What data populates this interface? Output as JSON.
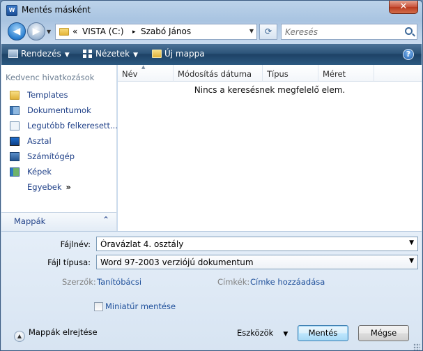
{
  "window": {
    "title": "Mentés másként",
    "app_icon_text": "W",
    "close_glyph": "✕"
  },
  "navigation": {
    "back_glyph": "◀",
    "forward_glyph": "▶",
    "breadcrumb_prefix": "«",
    "breadcrumb": [
      "VISTA (C:)",
      "Szabó János"
    ],
    "separator": "▸",
    "refresh_glyph": "⟳",
    "search_placeholder": "Keresés"
  },
  "toolbar": {
    "organize_label": "Rendezés",
    "views_label": "Nézetek",
    "new_folder_label": "Új mappa",
    "help_glyph": "?"
  },
  "favorites": {
    "heading": "Kedvenc hivatkozások",
    "items": [
      {
        "label": "Templates",
        "icon": "folder-icon"
      },
      {
        "label": "Dokumentumok",
        "icon": "documents-icon"
      },
      {
        "label": "Legutóbb felkeresett...",
        "icon": "recent-places-icon"
      },
      {
        "label": "Asztal",
        "icon": "desktop-icon"
      },
      {
        "label": "Számítógép",
        "icon": "computer-icon"
      },
      {
        "label": "Képek",
        "icon": "pictures-icon"
      }
    ],
    "more_label": "Egyebek",
    "more_glyph": "»",
    "folders_label": "Mappák",
    "folders_chevron": "⌃"
  },
  "file_list": {
    "columns": [
      "Név",
      "Módosítás dátuma",
      "Típus",
      "Méret"
    ],
    "empty_message": "Nincs a keresésnek megfelelő elem."
  },
  "details": {
    "filename_label": "Fájlnév:",
    "filename_value": "Óravázlat 4. osztály",
    "filetype_label": "Fájl típusa:",
    "filetype_value": "Word 97-2003 verziójú dokumentum",
    "authors_label": "Szerzők:",
    "authors_value": "Tanítóbácsi",
    "tags_label": "Címkék:",
    "tags_value": "Címke hozzáadása",
    "thumbnail_label": "Miniatűr mentése",
    "thumbnail_checked": false
  },
  "footer": {
    "hide_folders_label": "Mappák elrejtése",
    "tools_label": "Eszközök",
    "save_label": "Mentés",
    "cancel_label": "Mégse"
  },
  "colors": {
    "accent": "#1e3f87",
    "toolbar": "#2c5479",
    "close": "#c8513a"
  }
}
